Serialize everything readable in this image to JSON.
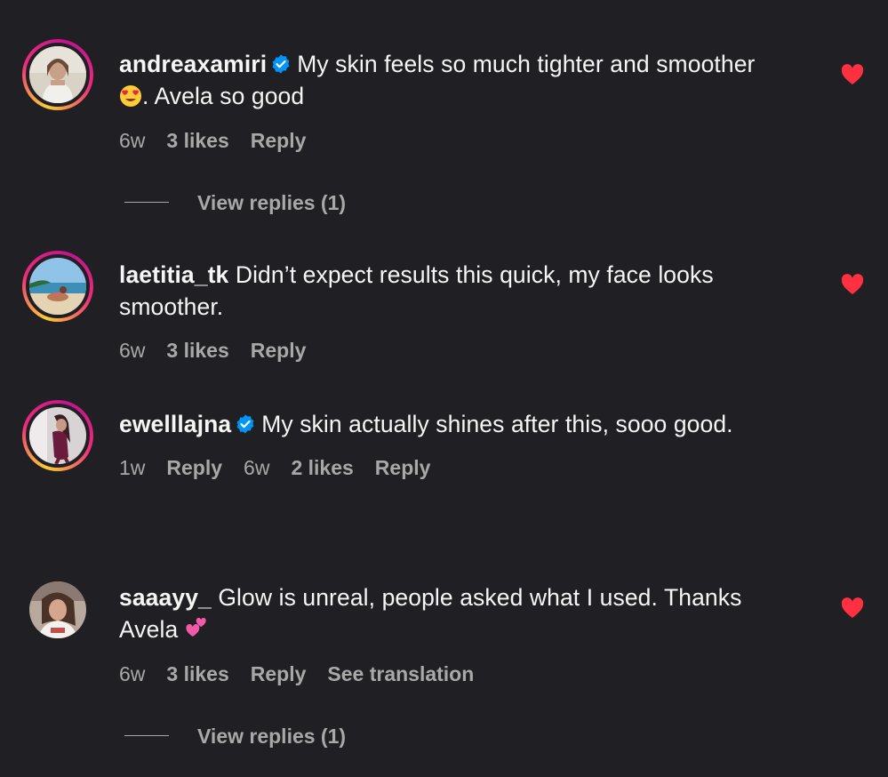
{
  "comments": [
    {
      "username": "andreaxamiri",
      "verified": true,
      "text_line1": "My skin feels so much tighter and smoother",
      "text_line2": ". Avela so good",
      "emoji": "😍",
      "time": "6w",
      "likes": "3 likes",
      "reply": "Reply",
      "liked": true,
      "view_replies": "View replies (1)"
    },
    {
      "username": "laetitia_tk",
      "verified": false,
      "text": "Didn’t expect results this quick, my face looks smoother.",
      "time": "6w",
      "likes": "3 likes",
      "reply": "Reply",
      "liked": true
    },
    {
      "username": "ewelllajna",
      "verified": true,
      "text": "My skin actually shines after this, sooo good.",
      "time": "1w",
      "reply": "Reply",
      "time2": "6w",
      "likes": "2 likes",
      "reply2": "Reply",
      "liked": false
    },
    {
      "username": "saaayy_",
      "verified": false,
      "text_line1": "Glow is unreal, people asked what I used. Thanks",
      "text_line2": "Avela",
      "emoji": "💞",
      "time": "6w",
      "likes": "3 likes",
      "reply": "Reply",
      "translation": "See translation",
      "liked": true,
      "view_replies": "View replies (1)"
    }
  ],
  "colors": {
    "background": "#202024",
    "text": "#f5f5f5",
    "secondary": "#a8a8a8",
    "heart": "#ff3040",
    "verified": "#0095f6"
  },
  "icons": {
    "verified": "verified-badge-icon",
    "heart": "heart-filled-icon"
  }
}
